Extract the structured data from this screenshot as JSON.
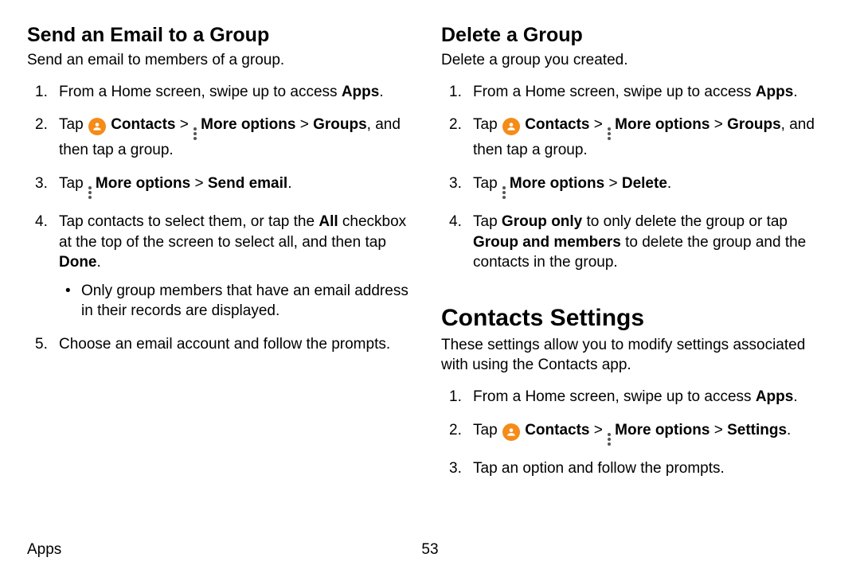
{
  "footer": {
    "section": "Apps",
    "page": "53"
  },
  "left": {
    "title": "Send an Email to a Group",
    "intro": "Send an email to members of a group.",
    "steps": {
      "s1_a": "From a Home screen, swipe up to access ",
      "s1_b": "Apps",
      "s1_c": ".",
      "s2_a": "Tap ",
      "s2_b": "Contacts",
      "s2_c": " > ",
      "s2_d": "More options",
      "s2_e": " > ",
      "s2_f": "Groups",
      "s2_g": ", and then tap a group.",
      "s3_a": "Tap ",
      "s3_b": "More options",
      "s3_c": " > ",
      "s3_d": "Send email",
      "s3_e": ".",
      "s4_a": "Tap contacts to select them, or tap the ",
      "s4_b": "All",
      "s4_c": " checkbox at the top of the screen to select all, and then tap ",
      "s4_d": "Done",
      "s4_e": ".",
      "s4_bullet": "Only group members that have an email address in their records are displayed.",
      "s5": "Choose an email account and follow the prompts."
    }
  },
  "right": {
    "delete": {
      "title": "Delete a Group",
      "intro": "Delete a group you created.",
      "s1_a": "From a Home screen, swipe up to access ",
      "s1_b": "Apps",
      "s1_c": ".",
      "s2_a": "Tap ",
      "s2_b": "Contacts",
      "s2_c": " > ",
      "s2_d": "More options",
      "s2_e": " > ",
      "s2_f": "Groups",
      "s2_g": ", and then tap a group.",
      "s3_a": "Tap ",
      "s3_b": "More options",
      "s3_c": " > ",
      "s3_d": "Delete",
      "s3_e": ".",
      "s4_a": "Tap ",
      "s4_b": "Group only",
      "s4_c": " to only delete the group or tap ",
      "s4_d": "Group and members",
      "s4_e": " to delete the group and the contacts in the group."
    },
    "settings": {
      "title": "Contacts Settings",
      "intro": "These settings allow you to modify settings associated with using the Contacts app.",
      "s1_a": "From a Home screen, swipe up to access ",
      "s1_b": "Apps",
      "s1_c": ".",
      "s2_a": "Tap ",
      "s2_b": "Contacts",
      "s2_c": " > ",
      "s2_d": "More options",
      "s2_e": " > ",
      "s2_f": "Settings",
      "s2_g": ".",
      "s3": "Tap an option and follow the prompts."
    }
  }
}
